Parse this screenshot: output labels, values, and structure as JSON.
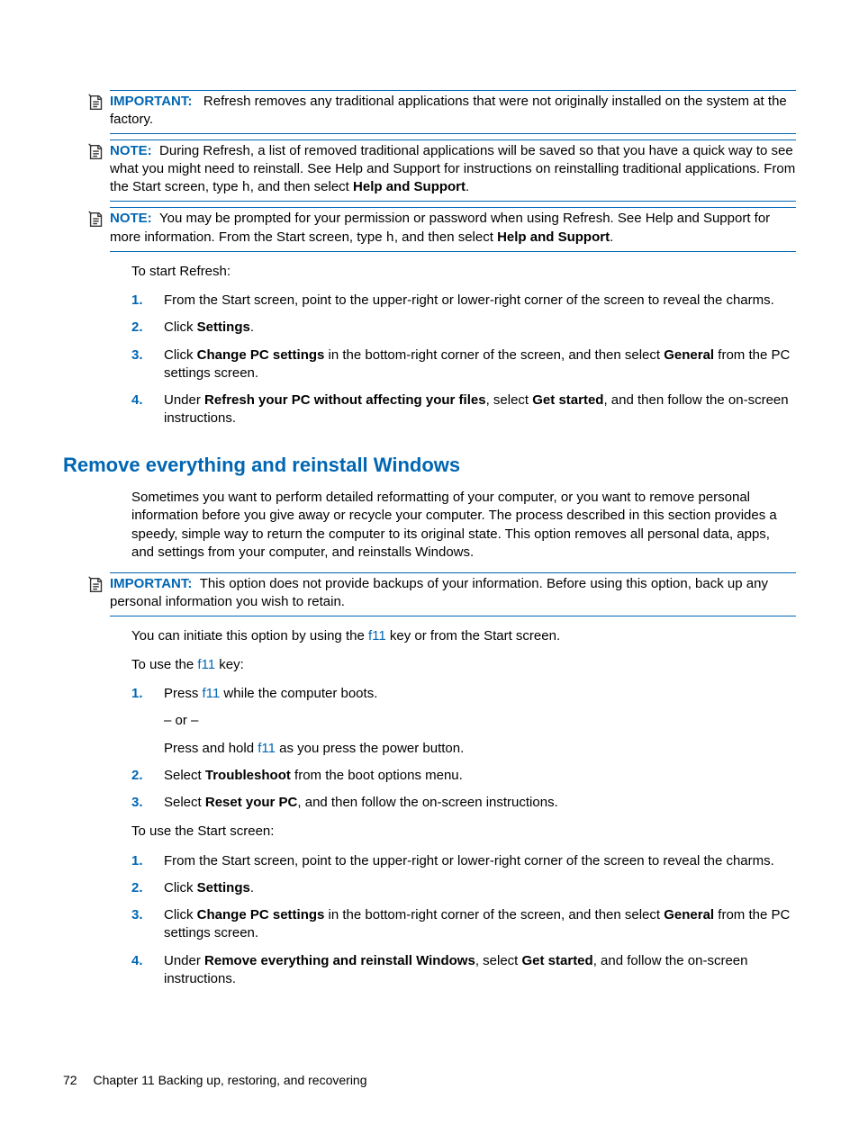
{
  "callouts": {
    "important1_label": "IMPORTANT:",
    "important1_text": "Refresh removes any traditional applications that were not originally installed on the system at the factory.",
    "note1_label": "NOTE:",
    "note1_a": "During Refresh, a list of removed traditional applications will be saved so that you have a quick way to see what you might need to reinstall. See Help and Support for instructions on reinstalling traditional applications. From the Start screen, type ",
    "note1_key": "h",
    "note1_b": ", and then select ",
    "note1_bold": "Help and Support",
    "note1_c": ".",
    "note2_label": "NOTE:",
    "note2_a": "You may be prompted for your permission or password when using Refresh. See Help and Support for more information. From the Start screen, type ",
    "note2_key": "h",
    "note2_b": ", and then select ",
    "note2_bold": "Help and Support",
    "note2_c": ".",
    "important2_label": "IMPORTANT:",
    "important2_text": "This option does not provide backups of your information. Before using this option, back up any personal information you wish to retain."
  },
  "text": {
    "to_start_refresh": "To start Refresh:",
    "heading": "Remove everything and reinstall Windows",
    "intro": "Sometimes you want to perform detailed reformatting of your computer, or you want to remove personal information before you give away or recycle your computer. The process described in this section provides a speedy, simple way to return the computer to its original state. This option removes all personal data, apps, and settings from your computer, and reinstalls Windows.",
    "initiate_a": "You can initiate this option by using the ",
    "f11": "f11",
    "initiate_b": " key or from the Start screen.",
    "to_use_f11_a": "To use the ",
    "to_use_f11_b": " key:",
    "to_use_start": "To use the Start screen:"
  },
  "steps_refresh": {
    "s1": "From the Start screen, point to the upper-right or lower-right corner of the screen to reveal the charms.",
    "s2_a": "Click ",
    "s2_bold": "Settings",
    "s2_b": ".",
    "s3_a": "Click ",
    "s3_bold1": "Change PC settings",
    "s3_b": " in the bottom-right corner of the screen, and then select ",
    "s3_bold2": "General",
    "s3_c": " from the PC settings screen.",
    "s4_a": "Under ",
    "s4_bold1": "Refresh your PC without affecting your files",
    "s4_b": ", select ",
    "s4_bold2": "Get started",
    "s4_c": ", and then follow the on-screen instructions."
  },
  "steps_f11": {
    "s1_a": "Press ",
    "s1_b": " while the computer boots.",
    "s1_or": "– or –",
    "s1_c": "Press and hold ",
    "s1_d": " as you press the power button.",
    "s2_a": "Select ",
    "s2_bold": "Troubleshoot",
    "s2_b": " from the boot options menu.",
    "s3_a": "Select ",
    "s3_bold": "Reset your PC",
    "s3_b": ", and then follow the on-screen instructions."
  },
  "steps_start": {
    "s1": "From the Start screen, point to the upper-right or lower-right corner of the screen to reveal the charms.",
    "s2_a": "Click ",
    "s2_bold": "Settings",
    "s2_b": ".",
    "s3_a": "Click ",
    "s3_bold1": "Change PC settings",
    "s3_b": " in the bottom-right corner of the screen, and then select ",
    "s3_bold2": "General",
    "s3_c": " from the PC settings screen.",
    "s4_a": "Under ",
    "s4_bold1": "Remove everything and reinstall Windows",
    "s4_b": ", select ",
    "s4_bold2": "Get started",
    "s4_c": ", and follow the on-screen instructions."
  },
  "footer": {
    "page": "72",
    "chapter": "Chapter 11   Backing up, restoring, and recovering"
  }
}
